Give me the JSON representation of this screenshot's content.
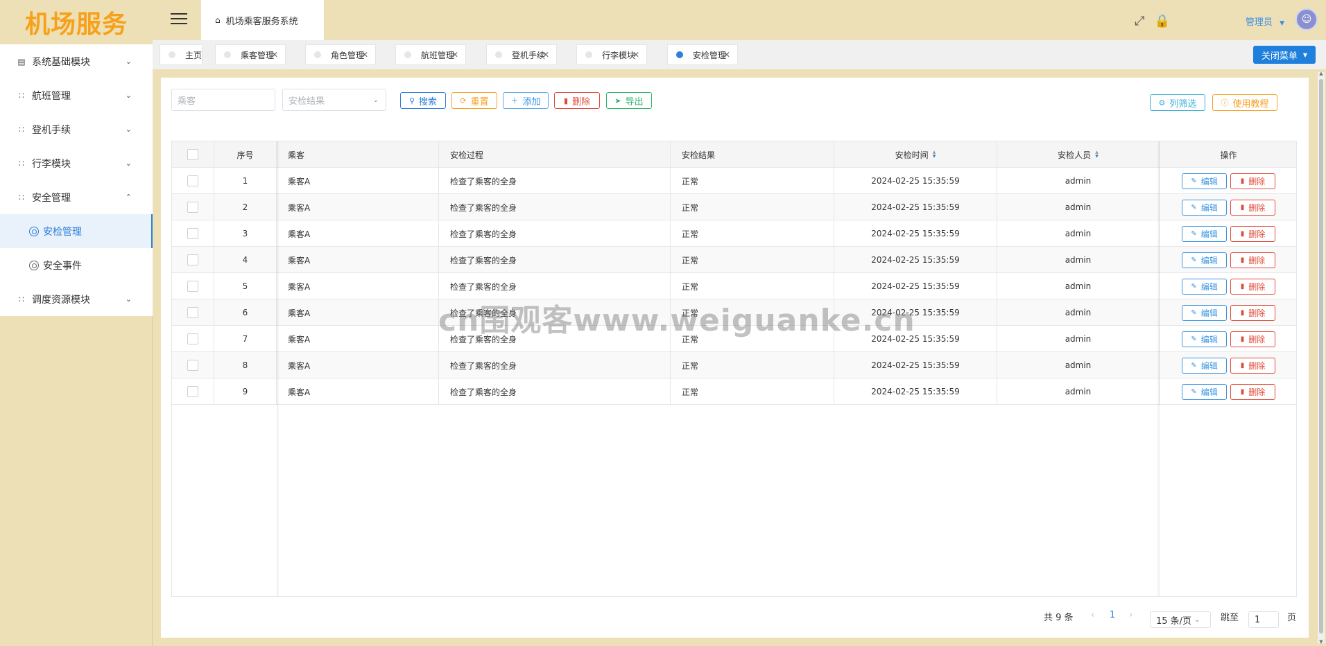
{
  "app": {
    "logo": "机场服务",
    "system_name": "机场乘客服务系统"
  },
  "header": {
    "user_label": "管理员",
    "fullscreen_icon": "fullscreen-icon",
    "lock_icon": "lock-icon"
  },
  "sidebar": {
    "items": [
      {
        "label": "系统基础模块",
        "icon": "chart-icon",
        "expanded": false
      },
      {
        "label": "航班管理",
        "icon": "grid-icon",
        "expanded": false
      },
      {
        "label": "登机手续",
        "icon": "grid-icon",
        "expanded": false
      },
      {
        "label": "行李模块",
        "icon": "grid-icon",
        "expanded": false
      },
      {
        "label": "安全管理",
        "icon": "grid-icon",
        "expanded": true,
        "children": [
          {
            "label": "安检管理",
            "active": true
          },
          {
            "label": "安全事件",
            "active": false
          }
        ]
      },
      {
        "label": "调度资源模块",
        "icon": "grid-icon",
        "expanded": false
      }
    ]
  },
  "tabs": [
    {
      "label": "主页",
      "closable": false,
      "active": false
    },
    {
      "label": "乘客管理",
      "closable": true,
      "active": false
    },
    {
      "label": "角色管理",
      "closable": true,
      "active": false
    },
    {
      "label": "航班管理",
      "closable": true,
      "active": false
    },
    {
      "label": "登机手续",
      "closable": true,
      "active": false
    },
    {
      "label": "行李模块",
      "closable": true,
      "active": false
    },
    {
      "label": "安检管理",
      "closable": true,
      "active": true
    }
  ],
  "close_menu_label": "关闭菜单",
  "filters": {
    "passenger_placeholder": "乘客",
    "result_placeholder": "安检结果"
  },
  "toolbar": {
    "search": "搜索",
    "reset": "重置",
    "add": "添加",
    "delete": "删除",
    "export": "导出",
    "columns": "列筛选",
    "tutorial": "使用教程"
  },
  "table": {
    "columns": [
      "序号",
      "乘客",
      "安检过程",
      "安检结果",
      "安检时间",
      "安检人员",
      "操作"
    ],
    "rows": [
      {
        "no": "1",
        "passenger": "乘客A",
        "process": "检查了乘客的全身",
        "result": "正常",
        "time": "2024-02-25 15:35:59",
        "staff": "admin"
      },
      {
        "no": "2",
        "passenger": "乘客A",
        "process": "检查了乘客的全身",
        "result": "正常",
        "time": "2024-02-25 15:35:59",
        "staff": "admin"
      },
      {
        "no": "3",
        "passenger": "乘客A",
        "process": "检查了乘客的全身",
        "result": "正常",
        "time": "2024-02-25 15:35:59",
        "staff": "admin"
      },
      {
        "no": "4",
        "passenger": "乘客A",
        "process": "检查了乘客的全身",
        "result": "正常",
        "time": "2024-02-25 15:35:59",
        "staff": "admin"
      },
      {
        "no": "5",
        "passenger": "乘客A",
        "process": "检查了乘客的全身",
        "result": "正常",
        "time": "2024-02-25 15:35:59",
        "staff": "admin"
      },
      {
        "no": "6",
        "passenger": "乘客A",
        "process": "检查了乘客的全身",
        "result": "正常",
        "time": "2024-02-25 15:35:59",
        "staff": "admin"
      },
      {
        "no": "7",
        "passenger": "乘客A",
        "process": "检查了乘客的全身",
        "result": "正常",
        "time": "2024-02-25 15:35:59",
        "staff": "admin"
      },
      {
        "no": "8",
        "passenger": "乘客A",
        "process": "检查了乘客的全身",
        "result": "正常",
        "time": "2024-02-25 15:35:59",
        "staff": "admin"
      },
      {
        "no": "9",
        "passenger": "乘客A",
        "process": "检查了乘客的全身",
        "result": "正常",
        "time": "2024-02-25 15:35:59",
        "staff": "admin"
      }
    ],
    "edit_label": "编辑",
    "delete_label": "删除"
  },
  "pagination": {
    "total": "共 9 条",
    "current_page": "1",
    "page_size": "15 条/页",
    "goto_label": "跳至",
    "goto_value": "1",
    "page_unit": "页"
  },
  "watermark": "cn围观客www.weiguanke.cn",
  "colors": {
    "accent": "#2d7fd8",
    "logo": "#f7a019",
    "danger": "#e04a3a",
    "warning": "#f5a021",
    "success": "#2db36a",
    "sidebar_bg": "#ede0b6"
  }
}
